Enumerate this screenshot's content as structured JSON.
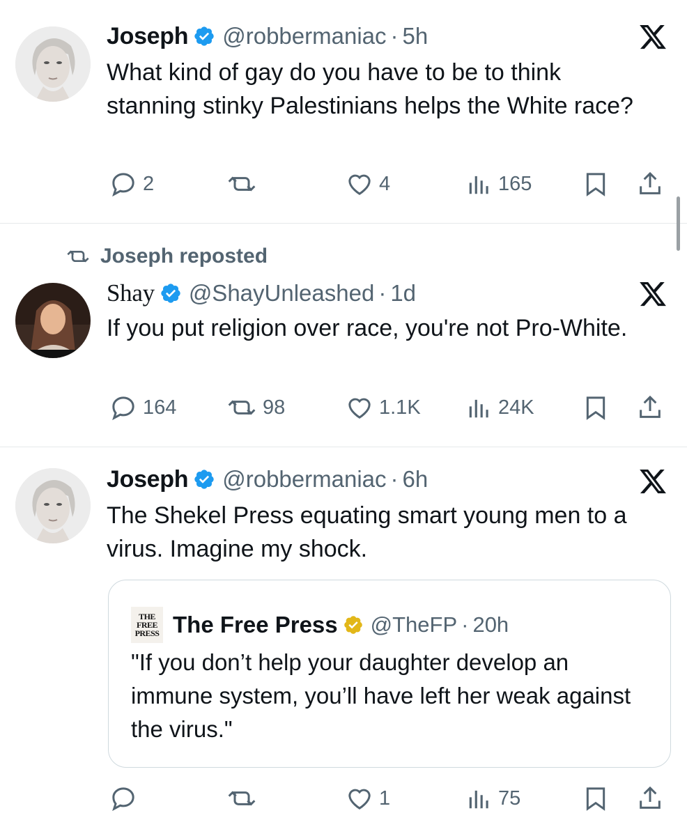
{
  "tweets": [
    {
      "author_name": "Joseph",
      "handle": "@robbermaniac",
      "separator": "·",
      "time": "5h",
      "text": "What kind of gay do you have to be to think stanning stinky Palestinians helps the White race?",
      "actions": {
        "replies": "2",
        "reposts": "",
        "likes": "4",
        "views": "165"
      }
    },
    {
      "repost_context": "Joseph reposted",
      "author_name": "Shay",
      "handle": "@ShayUnleashed",
      "separator": "·",
      "time": "1d",
      "text": "If you put religion over race, you're not Pro-White.",
      "actions": {
        "replies": "164",
        "reposts": "98",
        "likes": "1.1K",
        "views": "24K"
      }
    },
    {
      "author_name": "Joseph",
      "handle": "@robbermaniac",
      "separator": "·",
      "time": "6h",
      "text": "The Shekel Press equating smart young men to a virus. Imagine my shock.",
      "quote": {
        "logo_lines": [
          "THE",
          "FREE",
          "PRESS"
        ],
        "author_name": "The Free Press",
        "handle": "@TheFP",
        "separator": "·",
        "time": "20h",
        "text": "\"If you don’t help your daughter develop an immune system, you’ll have left her weak against the virus.\""
      },
      "actions": {
        "replies": "",
        "reposts": "",
        "likes": "1",
        "views": "75"
      }
    }
  ],
  "icons": {
    "verified_blue": "#1d9bf0",
    "verified_gold": "#e2b719",
    "action_gray": "#536471"
  }
}
